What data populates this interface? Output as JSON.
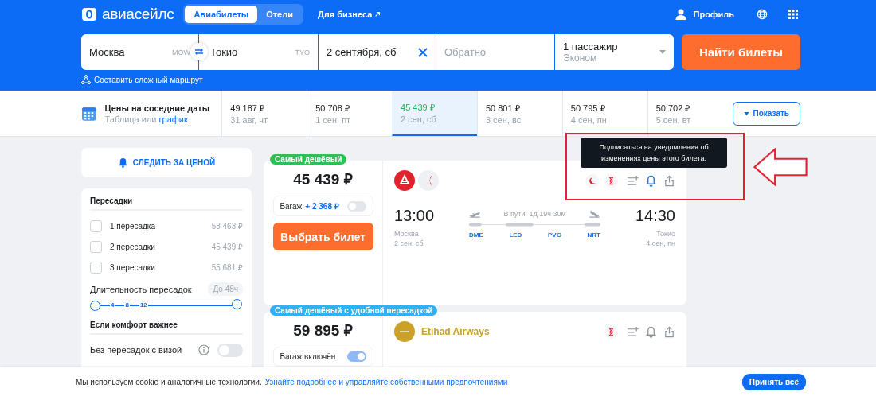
{
  "header": {
    "logo": "авиасейлс",
    "tabs": [
      {
        "label": "Авиабилеты",
        "selected": true
      },
      {
        "label": "Отели",
        "selected": false
      }
    ],
    "business_link": "Для бизнеса",
    "profile": "Профиль"
  },
  "search": {
    "origin": {
      "value": "Москва",
      "code": "MOW"
    },
    "destination": {
      "value": "Токио",
      "code": "TYO"
    },
    "depart": {
      "value": "2 сентября, сб"
    },
    "return": {
      "placeholder": "Обратно"
    },
    "passengers": {
      "value": "1 пассажир",
      "cabin": "Эконом"
    },
    "button": "Найти билеты",
    "complex_route": "Составить сложный маршрут"
  },
  "dates": {
    "title": "Цены на соседние даты",
    "subtitle": "Таблица или",
    "subtitle_link": "график",
    "items": [
      {
        "price": "49 187 ₽",
        "date": "31 авг, чт",
        "selected": false
      },
      {
        "price": "50 708 ₽",
        "date": "1 сен, пт",
        "selected": false
      },
      {
        "price": "45 439 ₽",
        "date": "2 сен, сб",
        "selected": true
      },
      {
        "price": "50 801 ₽",
        "date": "3 сен, вс",
        "selected": false
      },
      {
        "price": "50 795 ₽",
        "date": "4 сен, пн",
        "selected": false
      },
      {
        "price": "50 702 ₽",
        "date": "5 сен, вт",
        "selected": false
      }
    ],
    "show_button": "Показать"
  },
  "sidebar": {
    "track_price": "СЛЕДИТЬ ЗА ЦЕНОЙ",
    "stops": {
      "title": "Пересадки",
      "options": [
        {
          "label": "1 пересадка",
          "price": "58 463 ₽",
          "checked": false
        },
        {
          "label": "2 пересадки",
          "price": "45 439 ₽",
          "checked": false
        },
        {
          "label": "3 пересадки",
          "price": "55 681 ₽",
          "checked": false
        }
      ]
    },
    "duration": {
      "label": "Длительность пересадок",
      "badge": "До 48ч",
      "ticks": [
        "4",
        "8",
        "12"
      ],
      "level": 1
    },
    "comfort": {
      "title": "Если комфорт важнее",
      "options": [
        {
          "label": "Без пересадок с визой",
          "on": false
        }
      ]
    }
  },
  "tickets": [
    {
      "badge": "Самый дешёвый",
      "color": "#2fbf55",
      "price": "45 439 ₽",
      "baggage": {
        "label": "Багаж",
        "extra": "+ 2 368 ₽",
        "on": false
      },
      "button": "Выбрать билет",
      "airline_logos": [
        {
          "kind": "red"
        },
        {
          "kind": "white"
        }
      ],
      "tags": [
        {
          "kind": "night"
        },
        {
          "kind": "layover"
        }
      ],
      "bell_active": true,
      "flight": {
        "depart_time": "13:00",
        "depart_city": "Москва",
        "depart_date": "2 сен, сб",
        "duration": "В пути: 1д 19ч 30м",
        "arrive_time": "14:30",
        "arrive_city": "Токио",
        "arrive_date": "4 сен, пн",
        "stops": [
          "DME",
          "LED",
          "PVG",
          "NRT"
        ]
      }
    },
    {
      "badge": "Самый дешёвый с удобной пересадкой",
      "color": "#2fb2f5",
      "price": "59 895 ₽",
      "baggage": {
        "label": "Багаж включён",
        "on": true
      },
      "airline_logos": [
        {
          "kind": "gold"
        }
      ],
      "airline_name": "Etihad Airways",
      "tags": [
        {
          "kind": "layover"
        }
      ],
      "bell_active": false
    }
  ],
  "tooltip": "Подписаться на уведомления об изменениях цены этого билета.",
  "cookie": {
    "text": "Мы используем cookie и аналогичные технологии.",
    "link": "Узнайте подробнее и управляйте собственными предпочтениями",
    "button": "Принять всё"
  }
}
